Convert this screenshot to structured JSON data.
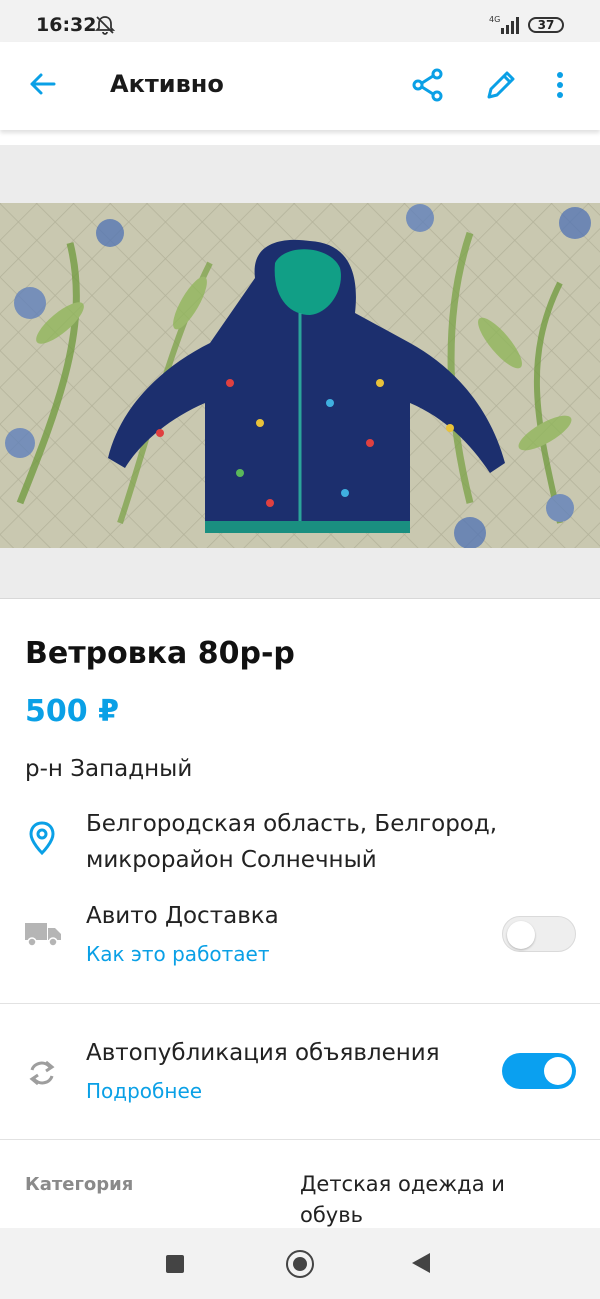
{
  "status_bar": {
    "time": "16:32",
    "network": "4G",
    "battery": "37"
  },
  "header": {
    "title": "Активно"
  },
  "listing": {
    "title": "Ветровка 80р-р",
    "price": "500 ₽",
    "district": "р-н Западный",
    "address": "Белгородская область, Белгород, микрорайон Солнечный"
  },
  "delivery": {
    "title": "Авито Доставка",
    "link": "Как это работает",
    "enabled": false
  },
  "autopublish": {
    "title": "Автопубликация объявления",
    "link": "Подробнее",
    "enabled": true
  },
  "details": {
    "category_label": "Категория",
    "category_value": "Детская одежда и обувь"
  },
  "colors": {
    "accent": "#0aa0e6",
    "toggle_on": "#0aa0f0"
  },
  "icons": [
    "bell-off-icon",
    "back-arrow-icon",
    "share-icon",
    "edit-icon",
    "more-icon",
    "location-pin-icon",
    "truck-icon",
    "refresh-icon"
  ]
}
